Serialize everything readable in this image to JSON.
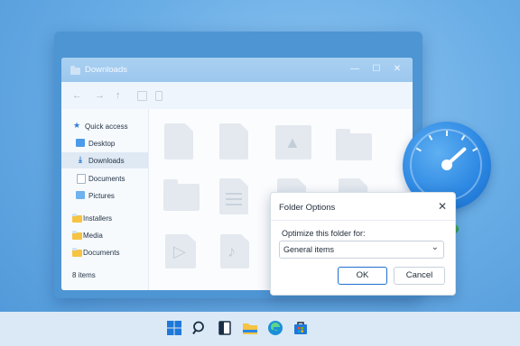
{
  "window": {
    "title": "Downloads",
    "controls": {
      "minimize": "—",
      "maximize": "☐",
      "close": "✕"
    }
  },
  "toolbar": {
    "back": "←",
    "forward": "→",
    "up": "↑"
  },
  "sidebar": {
    "quick_access": "Quick access",
    "items": [
      {
        "label": "Desktop",
        "icon": "desktop-icon"
      },
      {
        "label": "Downloads",
        "icon": "download-icon",
        "active": true
      },
      {
        "label": "Documents",
        "icon": "document-icon"
      },
      {
        "label": "Pictures",
        "icon": "pictures-icon"
      }
    ],
    "folders": [
      {
        "label": "Installers"
      },
      {
        "label": "Media"
      },
      {
        "label": "Documents"
      }
    ]
  },
  "status": {
    "item_count": "8 items"
  },
  "dialog": {
    "title": "Folder Options",
    "close": "✕",
    "label": "Optimize this folder for:",
    "select_value": "General items",
    "ok": "OK",
    "cancel": "Cancel"
  },
  "colors": {
    "accent": "#1f6fd0",
    "desktop_bg": "#6aaee6",
    "folder_yellow": "#f6c343"
  }
}
